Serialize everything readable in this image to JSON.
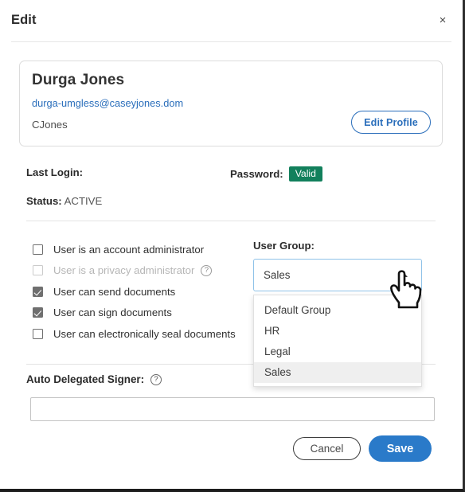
{
  "dialog": {
    "title": "Edit",
    "close_label": "×"
  },
  "profile": {
    "name": "Durga Jones",
    "email": "durga-umgless@caseyjones.dom",
    "username": "CJones",
    "edit_profile_label": "Edit Profile"
  },
  "info": {
    "last_login_label": "Last Login:",
    "last_login_value": "",
    "password_label": "Password:",
    "password_badge": "Valid",
    "password_badge_color": "#12805c",
    "status_label": "Status:",
    "status_value": "ACTIVE"
  },
  "permissions": [
    {
      "label": "User is an account administrator",
      "checked": false,
      "disabled": false,
      "help": false
    },
    {
      "label": "User is a privacy administrator",
      "checked": false,
      "disabled": true,
      "help": true
    },
    {
      "label": "User can send documents",
      "checked": true,
      "disabled": false,
      "help": false
    },
    {
      "label": "User can sign documents",
      "checked": true,
      "disabled": false,
      "help": false
    },
    {
      "label": "User can electronically seal documents",
      "checked": false,
      "disabled": false,
      "help": false
    }
  ],
  "user_group": {
    "label": "User Group:",
    "selected": "Sales",
    "expanded": true,
    "options": [
      "Default Group",
      "HR",
      "Legal",
      "Sales"
    ]
  },
  "auto_delegated_signer": {
    "label": "Auto Delegated Signer:",
    "help_icon": "?",
    "value": "",
    "placeholder": ""
  },
  "footer": {
    "cancel_label": "Cancel",
    "save_label": "Save",
    "save_color": "#2a7ac9"
  },
  "icons": {
    "help": "?",
    "close": "×"
  }
}
